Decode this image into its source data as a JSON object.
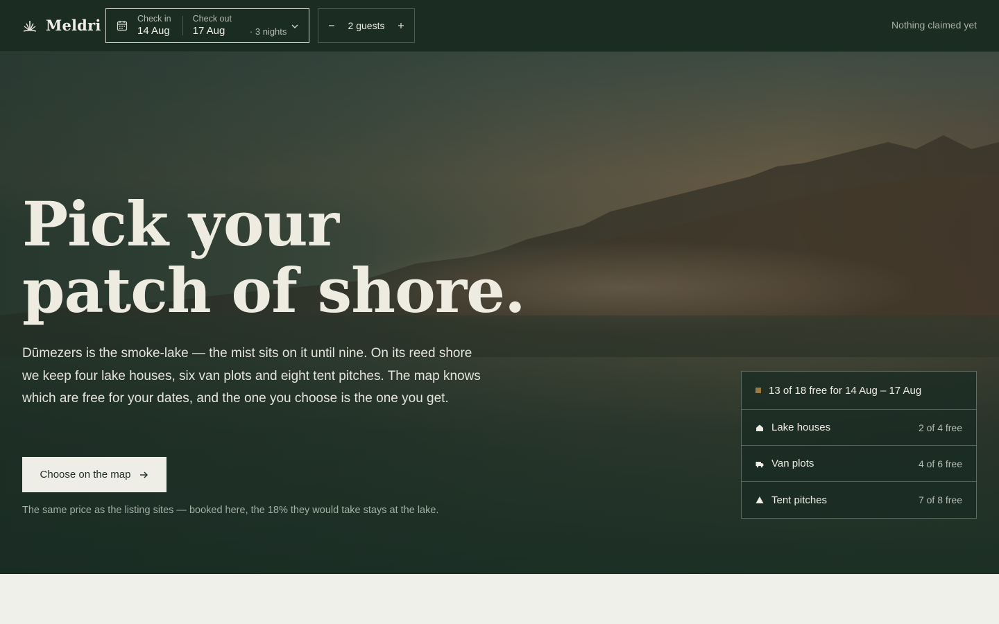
{
  "brand": {
    "name": "Meldri",
    "icon": "reed-logo-icon"
  },
  "dates": {
    "checkin_label": "Check in",
    "checkin_value": "14 Aug",
    "checkout_label": "Check out",
    "checkout_value": "17 Aug",
    "nights": "· 3 nights"
  },
  "guests": {
    "count_label": "2 guests"
  },
  "status": {
    "claimed": "Nothing claimed yet"
  },
  "hero": {
    "headline_line1": "Pick your",
    "headline_line2": "patch of shore.",
    "lead": "Dūmezers is the smoke-lake — the mist sits on it until nine. On its reed shore we keep four lake houses, six van plots and eight tent pitches. The map knows which are free for your dates, and the one you choose is the one you get.",
    "cta_label": "Choose on the map",
    "fineprint": "The same price as the listing sites — booked here, the 18% they would take stays at the lake."
  },
  "availability": {
    "summary": "13 of 18 free for 14 Aug – 17 Aug",
    "rows": [
      {
        "label": "Lake houses",
        "count": "2 of 4 free",
        "icon": "house-icon"
      },
      {
        "label": "Van plots",
        "count": "4 of 6 free",
        "icon": "van-icon"
      },
      {
        "label": "Tent pitches",
        "count": "7 of 8 free",
        "icon": "tent-icon"
      }
    ]
  },
  "colors": {
    "header_bg": "#1b2c23",
    "accent": "#9a7b3e",
    "cta_bg": "#eeeee6",
    "page_bg": "#eff0ea"
  }
}
